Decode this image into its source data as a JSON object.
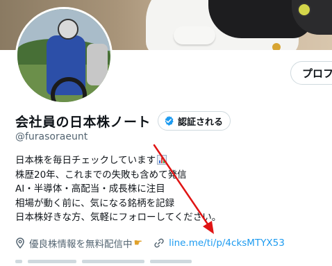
{
  "header": {
    "profile_button_label": "プロフ"
  },
  "profile": {
    "display_name": "会社員の日本株ノート",
    "verify_label": "認証される",
    "handle": "@furasoraeunt",
    "bio": [
      "日本株を毎日チェックしています",
      "株歴20年、これまでの失敗も含めて発信",
      "AI・半導体・高配当・成長株に注目",
      "相場が動く前に、気になる銘柄を記録",
      "日本株好きな方、気軽にフォローしてください。"
    ],
    "location": "優良株情報を無料配信中",
    "link": "line.me/ti/p/4cksMTYX53"
  },
  "icons": {
    "verify": "verified-badge-icon",
    "chart": "bar-chart-icon",
    "location": "location-pin-icon",
    "pointing": "pointing-hand-icon",
    "link": "link-icon"
  },
  "colors": {
    "link": "#1d9bf0",
    "arrow": "#e01414",
    "badge": "#1d9bf0"
  }
}
